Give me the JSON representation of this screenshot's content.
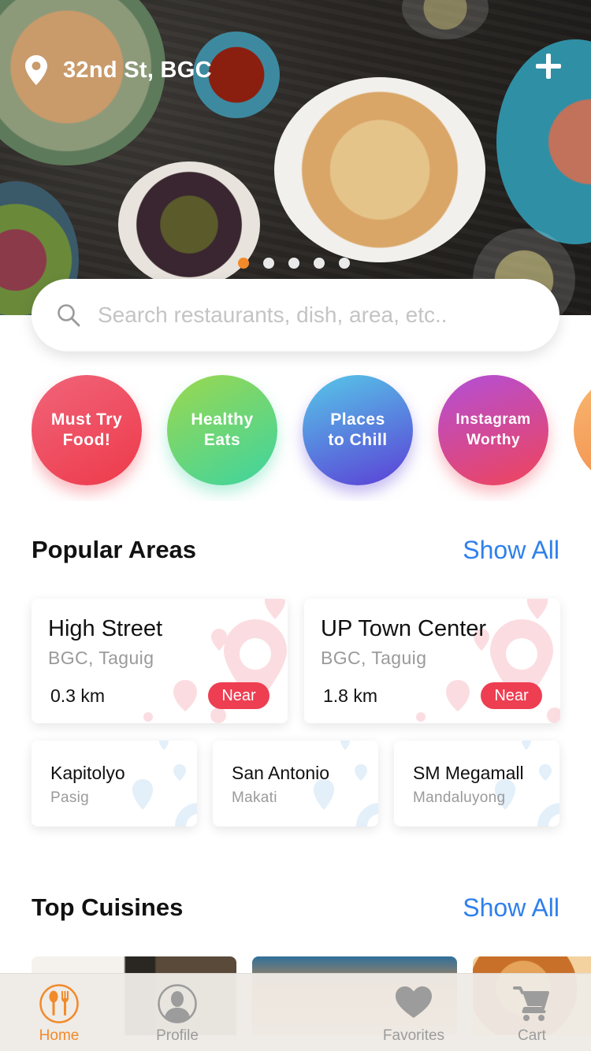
{
  "header": {
    "location": "32nd St, BGC",
    "location_icon": "map-pin-icon",
    "add_icon": "plus-icon",
    "carousel": {
      "count": 5,
      "active_index": 0
    }
  },
  "search": {
    "placeholder": "Search restaurants, dish, area, etc..",
    "value": "",
    "icon": "search-icon"
  },
  "categories": [
    {
      "label": "Must Try Food!",
      "line1": "Must Try",
      "line2": "Food!",
      "color_from": "#f0647a",
      "color_to": "#ee3a4a"
    },
    {
      "label": "Healthy Eats",
      "line1": "Healthy",
      "line2": "Eats",
      "color_from": "#9cd84f",
      "color_to": "#3dd4a0"
    },
    {
      "label": "Places to Chill",
      "line1": "Places",
      "line2": "to Chill",
      "color_from": "#56c8e8",
      "color_to": "#5b3fd6"
    },
    {
      "label": "Instagram Worthy",
      "line1": "Instagram",
      "line2": "Worthy",
      "color_from": "#b24fd8",
      "color_to": "#f0445a"
    }
  ],
  "popular_areas": {
    "title": "Popular Areas",
    "show_all": "Show All",
    "featured": [
      {
        "name": "High Street",
        "location": "BGC, Taguig",
        "distance": "0.3 km",
        "badge": "Near"
      },
      {
        "name": "UP Town Center",
        "location": "BGC, Taguig",
        "distance": "1.8 km",
        "badge": "Near"
      }
    ],
    "others": [
      {
        "name": "Kapitolyo",
        "location": "Pasig"
      },
      {
        "name": "San Antonio",
        "location": "Makati"
      },
      {
        "name": "SM Megamall",
        "location": "Mandaluyong"
      }
    ]
  },
  "top_cuisines": {
    "title": "Top Cuisines",
    "show_all": "Show All"
  },
  "tabbar": {
    "items": [
      {
        "label": "Home",
        "icon": "fork-spoon-icon",
        "active": true
      },
      {
        "label": "Profile",
        "icon": "user-icon",
        "active": false
      },
      {
        "label": "Favorites",
        "icon": "heart-icon",
        "active": false
      },
      {
        "label": "Cart",
        "icon": "cart-icon",
        "active": false
      }
    ]
  },
  "colors": {
    "accent_orange": "#f28a2a",
    "link_blue": "#2f80ed",
    "near_badge": "#ee3e52",
    "pin_pink": "#f7c1c8",
    "pin_blue": "#d6e8f6"
  }
}
